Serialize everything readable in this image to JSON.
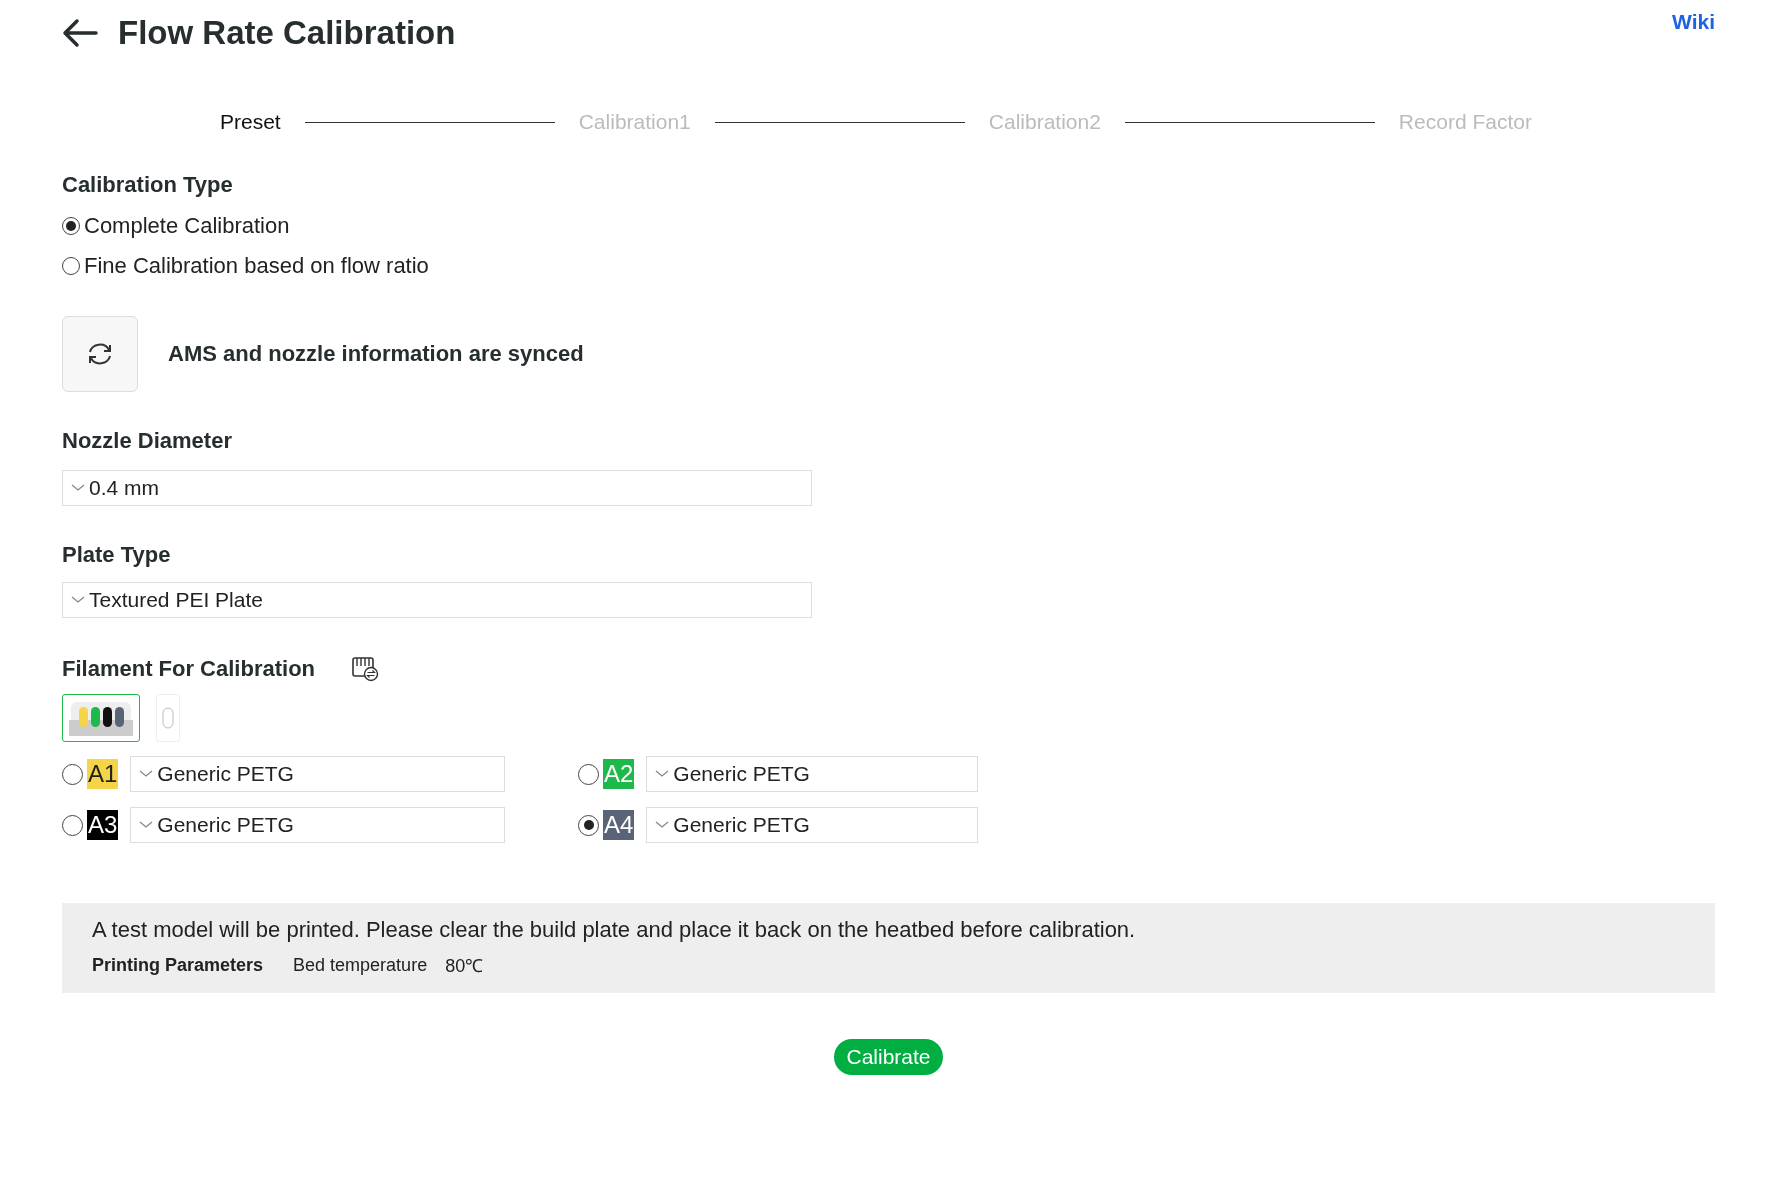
{
  "header": {
    "title": "Flow Rate Calibration",
    "link": "Wiki"
  },
  "steps": [
    {
      "label": "Preset",
      "selected": true
    },
    {
      "label": "Calibration1",
      "selected": false
    },
    {
      "label": "Calibration2",
      "selected": false
    },
    {
      "label": "Record Factor",
      "selected": false
    }
  ],
  "calibration_type": {
    "label": "Calibration Type",
    "options": [
      {
        "label": "Complete Calibration",
        "selected": true
      },
      {
        "label": "Fine Calibration based on flow ratio",
        "selected": false
      }
    ]
  },
  "sync": {
    "message": "AMS and nozzle information are synced"
  },
  "nozzle_diameter": {
    "label": "Nozzle Diameter",
    "value": "0.4 mm"
  },
  "plate_type": {
    "label": "Plate Type",
    "value": "Textured PEI Plate"
  },
  "filament": {
    "label": "Filament For Calibration",
    "sources": [
      {
        "kind": "ams",
        "selected": true,
        "spools": [
          {
            "color": "#f5d547"
          },
          {
            "color": "#1db94a"
          },
          {
            "color": "#111111"
          },
          {
            "color": "#5a6478"
          }
        ]
      },
      {
        "kind": "external",
        "selected": false
      }
    ],
    "slots": [
      {
        "tag": "A1",
        "color": "#f5d547",
        "value": "Generic PETG",
        "selected": false
      },
      {
        "tag": "A2",
        "color": "#1db94a",
        "value": "Generic PETG",
        "selected": false
      },
      {
        "tag": "A3",
        "color": "#000000",
        "value": "Generic PETG",
        "selected": false
      },
      {
        "tag": "A4",
        "color": "#5a6478",
        "value": "Generic PETG",
        "selected": true
      }
    ]
  },
  "notice": {
    "message": "A test model will be printed. Please clear the build plate and place it back on the heatbed before calibration.",
    "params_label": "Printing Parameters",
    "params": [
      {
        "name": "Bed temperature",
        "value": "80℃"
      }
    ]
  },
  "action": "Calibrate"
}
